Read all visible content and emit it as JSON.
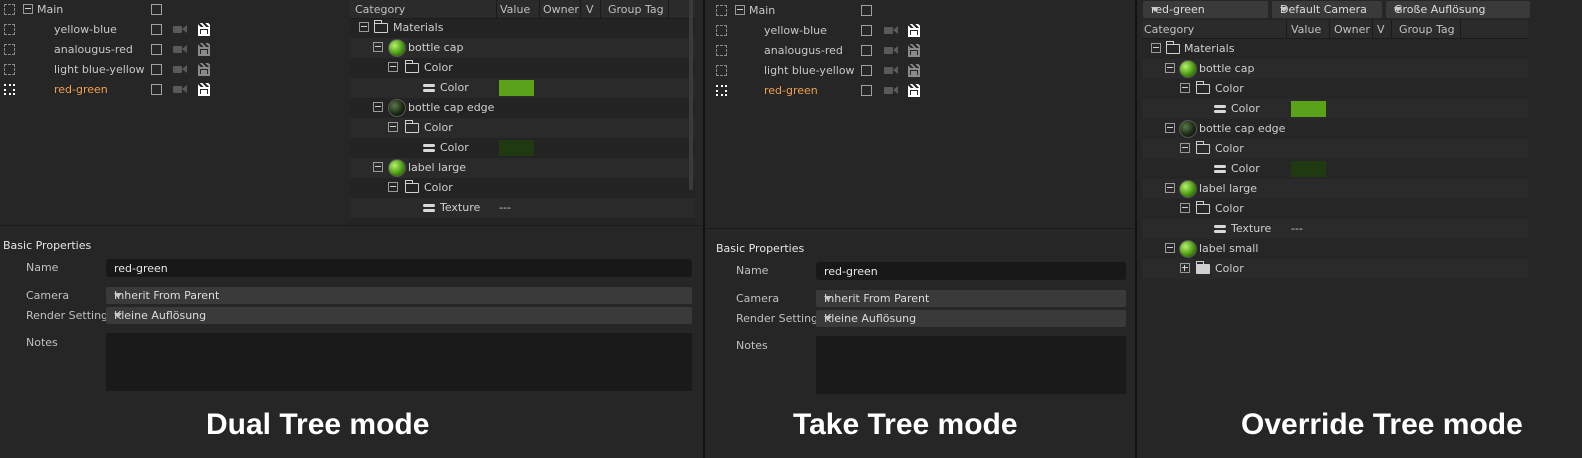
{
  "takes": {
    "main": "Main",
    "items": [
      "yellow-blue",
      "analougus-red",
      "light blue-yellow",
      "red-green"
    ],
    "active": "red-green"
  },
  "override_tree": {
    "columns": [
      "Category",
      "Value",
      "Owner",
      "V",
      "Group Tag"
    ],
    "rows": [
      {
        "label": "Materials",
        "kind": "folder"
      },
      {
        "label": "bottle cap",
        "kind": "material"
      },
      {
        "label": "Color",
        "kind": "folder"
      },
      {
        "label": "Color",
        "kind": "param",
        "value_color": "#5aa21a"
      },
      {
        "label": "bottle cap edge",
        "kind": "material-dark"
      },
      {
        "label": "Color",
        "kind": "folder"
      },
      {
        "label": "Color",
        "kind": "param",
        "value_color": "#1f3a10"
      },
      {
        "label": "label large",
        "kind": "material"
      },
      {
        "label": "Color",
        "kind": "folder"
      },
      {
        "label": "Texture",
        "kind": "param",
        "value_text": "---"
      },
      {
        "label": "label small",
        "kind": "material"
      },
      {
        "label": "Color",
        "kind": "folder-collapsed"
      }
    ]
  },
  "attributes": {
    "title": "Basic Properties",
    "name_label": "Name",
    "name_value": "red-green",
    "camera_label": "Camera",
    "camera_value": "Inherit From Parent",
    "render_label": "Render Settings",
    "render_value": "Kleine Auflösung",
    "notes_label": "Notes"
  },
  "override_top": {
    "take": "red-green",
    "camera": "Default Camera",
    "render": "Große Auflösung"
  },
  "captions": {
    "dual": "Dual Tree mode",
    "take": "Take Tree mode",
    "override": "Override Tree mode"
  },
  "colors": {
    "active_take": "#f0a050",
    "bottle_cap_color": "#5aa21a",
    "bottle_cap_edge_color": "#1f3a10"
  }
}
